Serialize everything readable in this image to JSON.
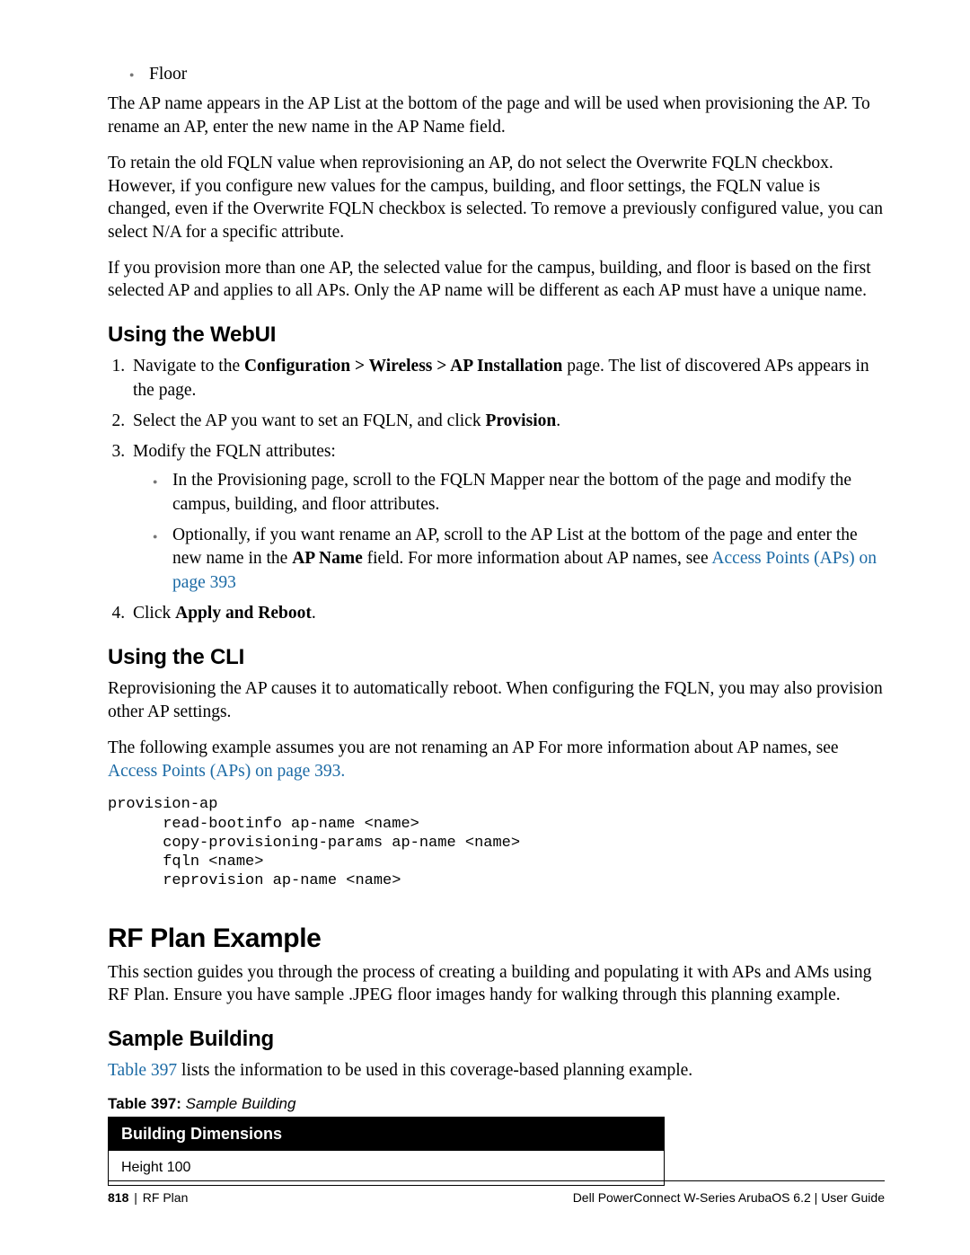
{
  "top_bullet": "Floor",
  "paras": {
    "p1": "The AP name appears in the AP List at the bottom of the page and will be used when provisioning the AP. To rename an AP, enter the new name in the AP Name field.",
    "p2": "To retain the old FQLN value when reprovisioning an AP, do not select the Overwrite FQLN checkbox. However, if you configure new values for the campus, building, and floor settings, the FQLN value is changed, even if the Overwrite FQLN checkbox is selected. To remove a previously configured value, you can select N/A for a specific attribute.",
    "p3": "If you provision more than one AP, the selected value for the campus, building, and floor is based on the first selected AP and applies to all APs. Only the AP name will be different as each AP must have a unique name."
  },
  "webui": {
    "heading": "Using the WebUI",
    "step1_pre": "Navigate to the ",
    "step1_bold": "Configuration > Wireless > AP Installation",
    "step1_post": " page. The list of discovered APs appears in the page.",
    "step2_pre": "Select the AP you want to set an FQLN, and click ",
    "step2_bold": "Provision",
    "step2_post": ".",
    "step3": "Modify the FQLN attributes:",
    "sub1": "In the Provisioning page, scroll to the FQLN Mapper near the bottom of the page and modify the campus, building, and floor attributes.",
    "sub2_pre": "Optionally, if you want rename an AP, scroll to the AP List at the bottom of the page and enter the new name in the ",
    "sub2_bold": "AP Name",
    "sub2_mid": " field. For more information about AP names, see ",
    "sub2_link": "Access Points (APs) on page 393",
    "step4_pre": "Click ",
    "step4_bold": "Apply and Reboot",
    "step4_post": "."
  },
  "cli": {
    "heading": "Using the CLI",
    "p1": "Reprovisioning the AP causes it to automatically reboot. When configuring the FQLN, you may also provision other AP settings.",
    "p2_pre": "The following example assumes you are not renaming an AP For more information about AP names, see ",
    "p2_link": "Access Points (APs) on page 393.",
    "code": "provision-ap\n      read-bootinfo ap-name <name>\n      copy-provisioning-params ap-name <name>\n      fqln <name>\n      reprovision ap-name <name>"
  },
  "rf": {
    "heading": "RF Plan Example",
    "p1": "This section guides you through the process of creating a building and populating it with APs and AMs using RF Plan. Ensure you have sample .JPEG floor images handy for walking through this planning example."
  },
  "sample": {
    "heading": "Sample Building",
    "link": "Table 397",
    "post": " lists the information to be used in this coverage-based planning example.",
    "caption_num": "Table 397:",
    "caption_name": " Sample Building",
    "th": "Building Dimensions",
    "row1": "Height 100"
  },
  "footer": {
    "pagenum": "818",
    "divider": " | ",
    "section": "RF Plan",
    "right": "Dell PowerConnect W-Series ArubaOS 6.2  |  User Guide"
  }
}
